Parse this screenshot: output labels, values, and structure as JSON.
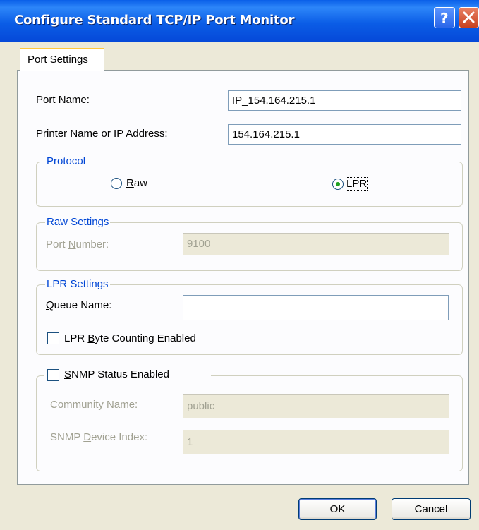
{
  "window": {
    "title": "Configure Standard TCP/IP Port Monitor"
  },
  "title_buttons": {
    "help": "?",
    "close": "close"
  },
  "tab": {
    "label": "Port Settings"
  },
  "port_name": {
    "label_first": "P",
    "label_rest": "ort Name:",
    "value": "IP_154.164.215.1"
  },
  "printer_address": {
    "label_pre": "Printer Name or IP ",
    "label_u": "A",
    "label_post": "ddress:",
    "value": "154.164.215.1"
  },
  "protocol": {
    "legend": "Protocol",
    "raw": {
      "u": "R",
      "rest": "aw",
      "selected": false
    },
    "lpr": {
      "u": "L",
      "rest": "PR",
      "selected": true
    }
  },
  "raw_settings": {
    "legend": "Raw Settings",
    "port_number_pre": "Port ",
    "port_number_u": "N",
    "port_number_post": "umber:",
    "port_number_value": "9100"
  },
  "lpr_settings": {
    "legend": "LPR Settings",
    "queue_u": "Q",
    "queue_rest": "ueue Name:",
    "queue_value": "",
    "byte_counting_pre": "LPR ",
    "byte_counting_u": "B",
    "byte_counting_post": "yte Counting Enabled",
    "byte_counting_checked": false
  },
  "snmp": {
    "u": "S",
    "rest": "NMP Status Enabled",
    "checked": false,
    "community_u": "C",
    "community_rest": "ommunity Name:",
    "community_value": "public",
    "device_pre": "SNMP ",
    "device_u": "D",
    "device_post": "evice Index:",
    "device_value": "1"
  },
  "buttons": {
    "ok": "OK",
    "cancel": "Cancel"
  },
  "icons": {
    "help": "question-icon",
    "close": "close-x-icon",
    "radio_dot": "radio-dot-icon"
  },
  "colors": {
    "title_bar": "#0A5FE8",
    "group_legend": "#0046D5",
    "disabled_text": "#A1A192",
    "radio_selected": "#21A121"
  }
}
